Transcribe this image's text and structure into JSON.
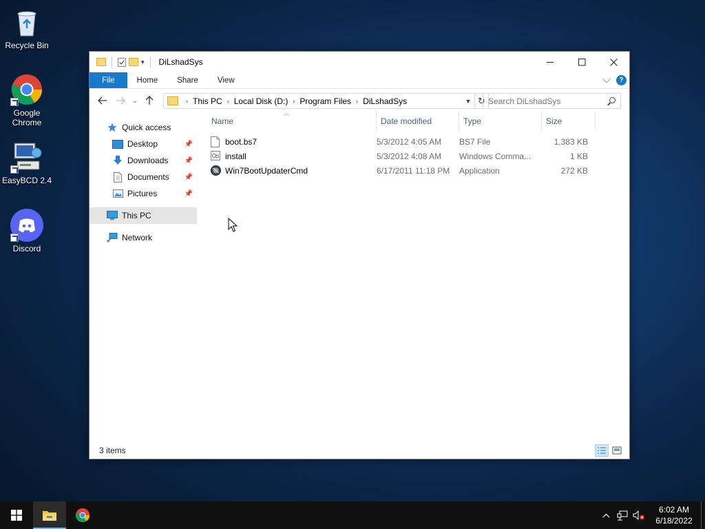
{
  "desktop": {
    "icons": [
      {
        "label": "Recycle Bin"
      },
      {
        "label": "Google Chrome"
      },
      {
        "label": "EasyBCD 2.4"
      },
      {
        "label": "Discord"
      }
    ]
  },
  "window": {
    "title": "DiLshadSys",
    "ribbon_tabs": [
      "File",
      "Home",
      "Share",
      "View"
    ],
    "breadcrumb": [
      "This PC",
      "Local Disk (D:)",
      "Program Files",
      "DiLshadSys"
    ],
    "search_placeholder": "Search DiLshadSys",
    "sidebar": {
      "quick_access": "Quick access",
      "quick_items": [
        "Desktop",
        "Downloads",
        "Documents",
        "Pictures"
      ],
      "this_pc": "This PC",
      "network": "Network"
    },
    "columns": [
      "Name",
      "Date modified",
      "Type",
      "Size"
    ],
    "files": [
      {
        "name": "boot.bs7",
        "date": "5/3/2012 4:05 AM",
        "type": "BS7 File",
        "size": "1,383 KB",
        "icon": "file-icon"
      },
      {
        "name": "install",
        "date": "5/3/2012 4:08 AM",
        "type": "Windows Comma...",
        "size": "1 KB",
        "icon": "script-icon"
      },
      {
        "name": "Win7BootUpdaterCmd",
        "date": "6/17/2011 11:18 PM",
        "type": "Application",
        "size": "272 KB",
        "icon": "app-icon"
      }
    ],
    "status": "3 items"
  },
  "taskbar": {
    "time": "6:02 AM",
    "date": "6/18/2022"
  },
  "colors": {
    "accent": "#1979ca",
    "folder": "#f8d775",
    "taskbar": "#101010"
  }
}
